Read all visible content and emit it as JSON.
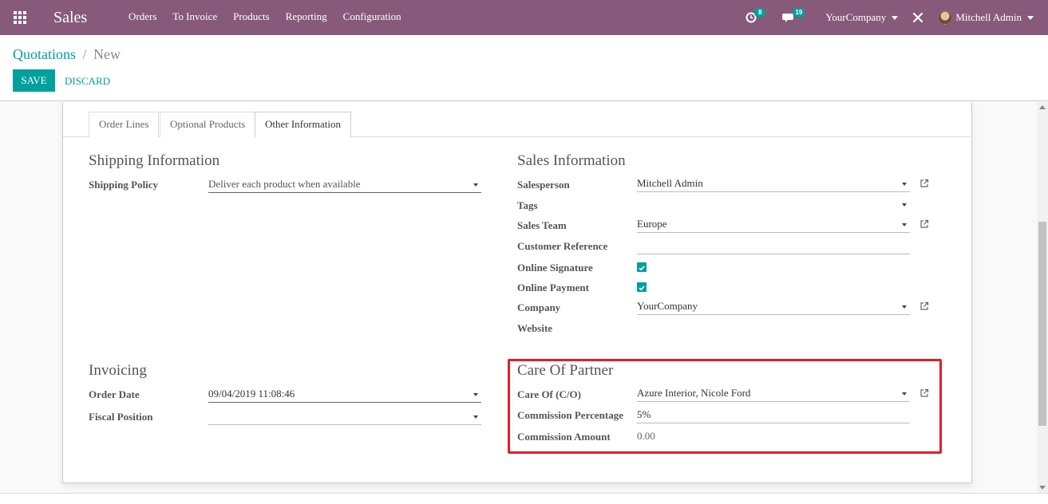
{
  "navbar": {
    "app_name": "Sales",
    "menu": [
      "Orders",
      "To Invoice",
      "Products",
      "Reporting",
      "Configuration"
    ],
    "activity_count": "8",
    "message_count": "19",
    "company": "YourCompany",
    "user": "Mitchell Admin",
    "colors": {
      "bar": "#875a7b",
      "badge": "#00a09d"
    }
  },
  "breadcrumb": {
    "parent": "Quotations",
    "separator": "/",
    "current": "New"
  },
  "actions": {
    "save": "SAVE",
    "discard": "DISCARD"
  },
  "tabs": [
    "Order Lines",
    "Optional Products",
    "Other Information"
  ],
  "active_tab": "Other Information",
  "shipping": {
    "title": "Shipping Information",
    "policy_label": "Shipping Policy",
    "policy_value": "Deliver each product when available"
  },
  "sales_info": {
    "title": "Sales Information",
    "salesperson_label": "Salesperson",
    "salesperson_value": "Mitchell Admin",
    "tags_label": "Tags",
    "team_label": "Sales Team",
    "team_value": "Europe",
    "customer_ref_label": "Customer Reference",
    "online_signature_label": "Online Signature",
    "online_signature_checked": true,
    "online_payment_label": "Online Payment",
    "online_payment_checked": true,
    "company_label": "Company",
    "company_value": "YourCompany",
    "website_label": "Website"
  },
  "invoicing": {
    "title": "Invoicing",
    "order_date_label": "Order Date",
    "order_date_value": "09/04/2019 11:08:46",
    "fiscal_label": "Fiscal Position"
  },
  "care_of": {
    "title": "Care Of Partner",
    "care_of_label": "Care Of (C/O)",
    "care_of_value": "Azure Interior, Nicole Ford",
    "commission_pct_label": "Commission Percentage",
    "commission_pct_value": "5%",
    "commission_amt_label": "Commission Amount",
    "commission_amt_value": "0.00",
    "highlight_color": "#e41e26"
  }
}
